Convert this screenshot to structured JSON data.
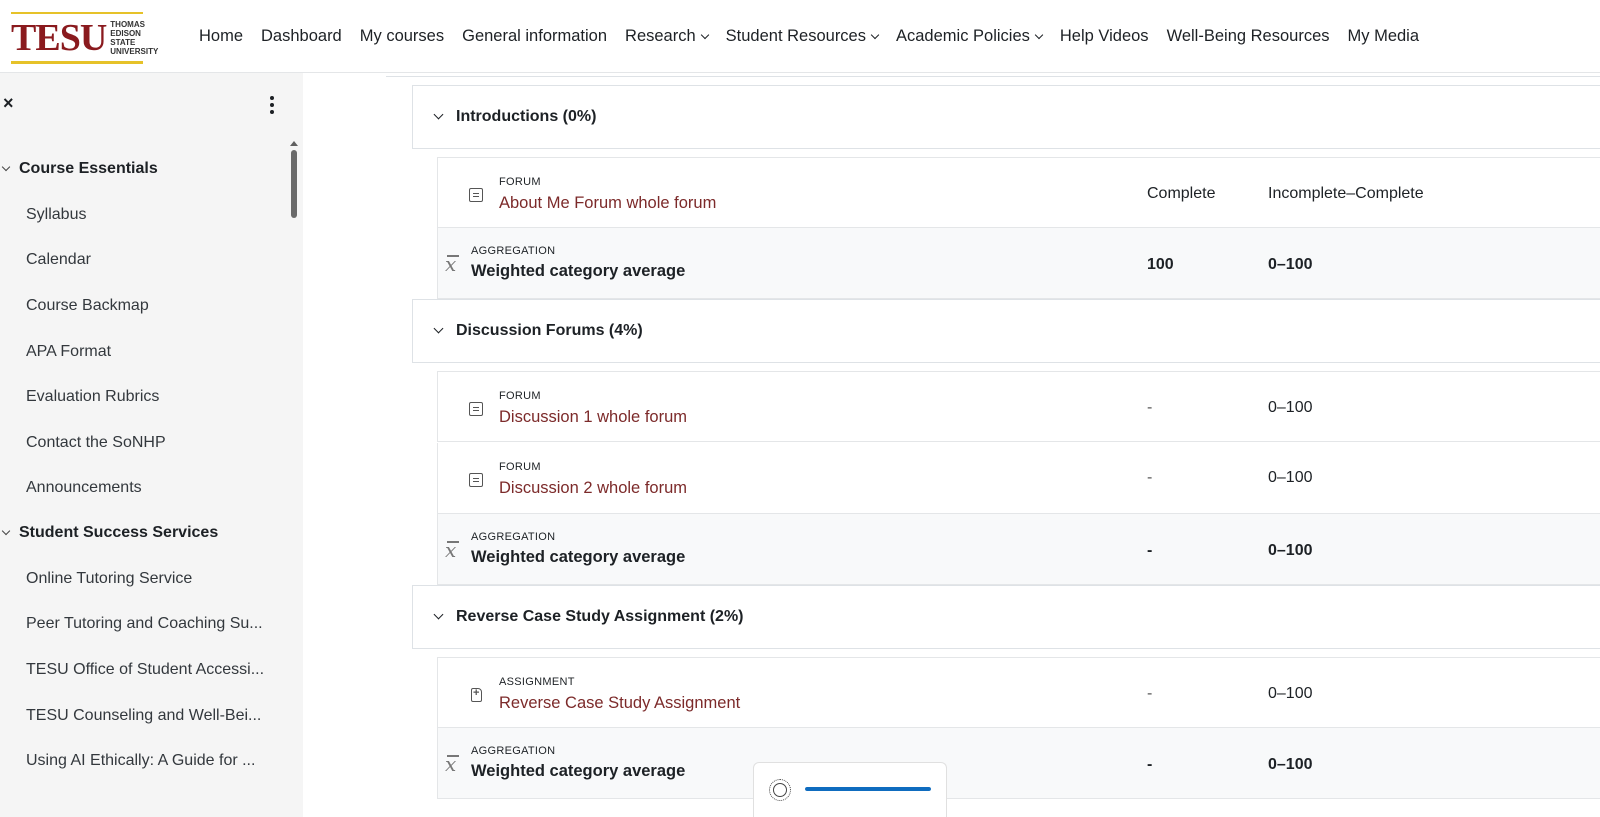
{
  "logo": {
    "main": "TESU",
    "sub_lines": [
      "THOMAS",
      "EDISON",
      "STATE",
      "UNIVERSITY"
    ]
  },
  "nav": {
    "items": [
      {
        "label": "Home",
        "dropdown": false
      },
      {
        "label": "Dashboard",
        "dropdown": false
      },
      {
        "label": "My courses",
        "dropdown": false
      },
      {
        "label": "General information",
        "dropdown": false
      },
      {
        "label": "Research",
        "dropdown": true
      },
      {
        "label": "Student Resources",
        "dropdown": true
      },
      {
        "label": "Academic Policies",
        "dropdown": true
      },
      {
        "label": "Help Videos",
        "dropdown": false
      },
      {
        "label": "Well-Being Resources",
        "dropdown": false
      },
      {
        "label": "My Media",
        "dropdown": false
      }
    ]
  },
  "drawer": {
    "close_icon": "×",
    "sections": [
      {
        "title": "Course Essentials",
        "items": [
          "Syllabus",
          "Calendar",
          "Course Backmap",
          "APA Format",
          "Evaluation Rubrics",
          "Contact the SoNHP",
          "Announcements"
        ]
      },
      {
        "title": "Student Success Services",
        "items": [
          "Online Tutoring Service",
          "Peer Tutoring and Coaching Su...",
          "TESU Office of Student Accessi...",
          "TESU Counseling and Well-Bei...",
          "Using AI Ethically: A Guide for ..."
        ]
      }
    ]
  },
  "grades": {
    "categories": [
      {
        "title": "Introductions (0%)",
        "items": [
          {
            "type": "FORUM",
            "name": "About Me Forum whole forum",
            "grade": "Complete",
            "range": "Incomplete–Complete",
            "icon": "forum-icon"
          }
        ],
        "aggregation": {
          "type": "AGGREGATION",
          "title": "Weighted category average",
          "grade": "100",
          "range": "0–100"
        }
      },
      {
        "title": "Discussion Forums (4%)",
        "items": [
          {
            "type": "FORUM",
            "name": "Discussion 1 whole forum",
            "grade": "-",
            "range": "0–100",
            "icon": "forum-icon"
          },
          {
            "type": "FORUM",
            "name": "Discussion 2 whole forum",
            "grade": "-",
            "range": "0–100",
            "icon": "forum-icon"
          }
        ],
        "aggregation": {
          "type": "AGGREGATION",
          "title": "Weighted category average",
          "grade": "-",
          "range": "0–100"
        }
      },
      {
        "title": "Reverse Case Study Assignment (2%)",
        "items": [
          {
            "type": "ASSIGNMENT",
            "name": "Reverse Case Study Assignment",
            "grade": "-",
            "range": "0–100",
            "icon": "assignment-icon"
          }
        ],
        "aggregation": {
          "type": "AGGREGATION",
          "title": "Weighted category average",
          "grade": "-",
          "range": "0–100"
        }
      }
    ]
  },
  "footer_widget": {
    "icon": "brightness-icon",
    "progress": 1.0
  },
  "colors": {
    "brand": "#8a1a1e",
    "link": "#7c2a2a",
    "accent": "#0f6cbf",
    "gold": "#e6c229"
  }
}
